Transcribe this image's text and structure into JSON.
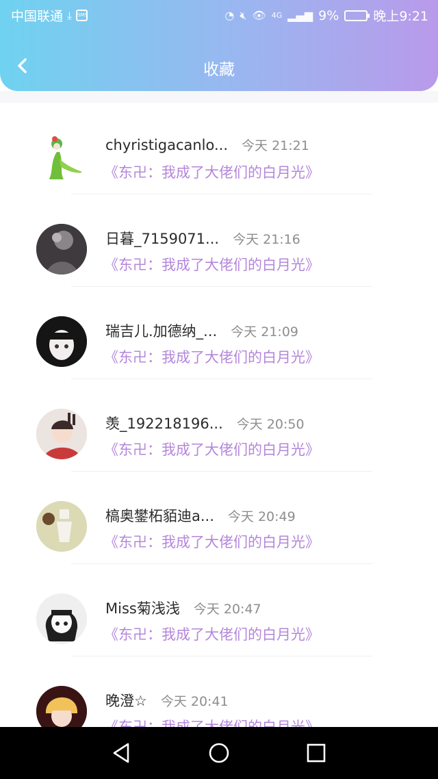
{
  "status_bar": {
    "carrier": "中国联通",
    "sms_icon_text": "SMS",
    "network": "4G",
    "battery": "9%",
    "time": "晚上9:21"
  },
  "header": {
    "title": "收藏"
  },
  "book_title": "《东卍：我成了大佬们的白月光》",
  "items": [
    {
      "name": "chyristigacanlo...",
      "time": "今天 21:21"
    },
    {
      "name": "日暮_7159071...",
      "time": "今天 21:16"
    },
    {
      "name": "瑞吉儿.加德纳_...",
      "time": "今天 21:09"
    },
    {
      "name": "羡_192218196...",
      "time": "今天 20:50"
    },
    {
      "name": "槁奥鐢柘貊迪a...",
      "time": "今天 20:49"
    },
    {
      "name": "Miss菊浅浅",
      "time": "今天 20:47"
    },
    {
      "name": "晚澄☆",
      "time": "今天 20:41"
    }
  ],
  "colors": {
    "accent": "#b486db",
    "header_start": "#6fd2f0",
    "header_end": "#b99aea"
  }
}
